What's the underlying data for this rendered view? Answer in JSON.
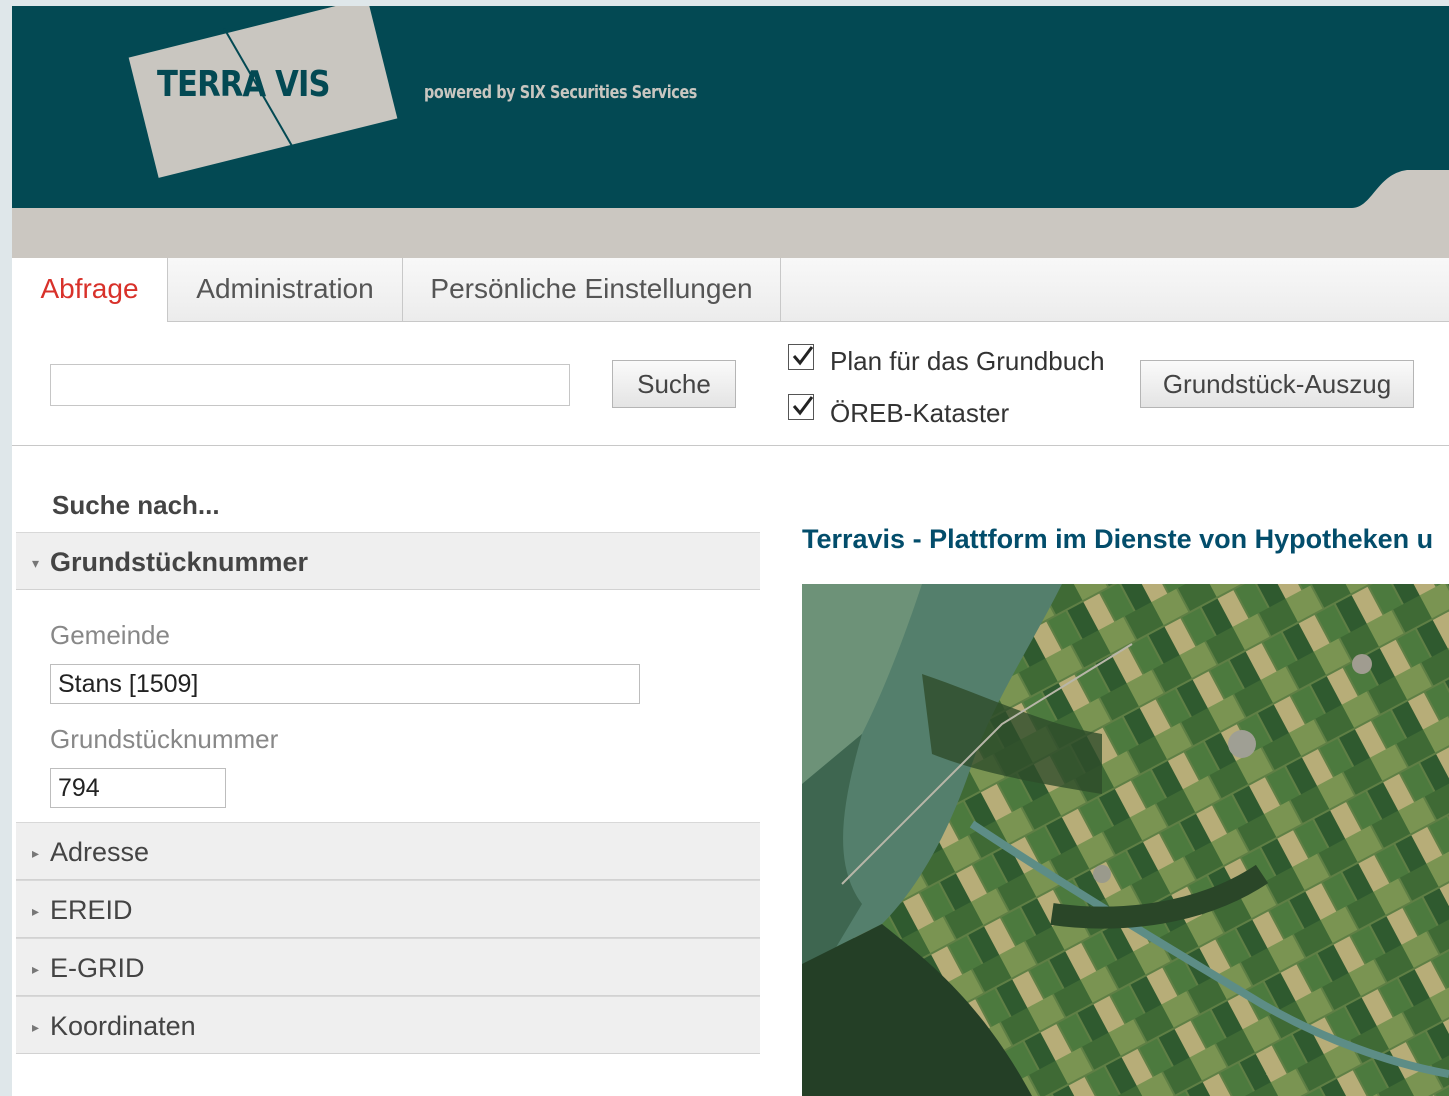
{
  "header": {
    "logo_text": "TERRA VIS",
    "tagline": "powered by SIX Securities Services"
  },
  "tabs": [
    {
      "label": "Abfrage",
      "active": true
    },
    {
      "label": "Administration",
      "active": false
    },
    {
      "label": "Persönliche Einstellungen",
      "active": false
    }
  ],
  "search": {
    "value": "",
    "placeholder": "",
    "button_label": "Suche"
  },
  "options": {
    "plan_label": "Plan für das Grundbuch",
    "plan_checked": true,
    "oereb_label": "ÖREB-Kataster",
    "oereb_checked": true,
    "extract_button_label": "Grundstück-Auszug"
  },
  "sidebar": {
    "heading": "Suche nach...",
    "sections": [
      {
        "label": "Grundstücknummer",
        "expanded": true
      },
      {
        "label": "Adresse",
        "expanded": false
      },
      {
        "label": "EREID",
        "expanded": false
      },
      {
        "label": "E-GRID",
        "expanded": false
      },
      {
        "label": "Koordinaten",
        "expanded": false
      }
    ],
    "grundstuck_form": {
      "gemeinde_label": "Gemeinde",
      "gemeinde_value": "Stans [1509]",
      "nummer_label": "Grundstücknummer",
      "nummer_value": "794"
    }
  },
  "main": {
    "title": "Terravis - Plattform im Dienste von Hypotheken u"
  },
  "colors": {
    "header_bg": "#034953",
    "active_tab": "#d8312a",
    "title": "#034d6b",
    "logo_bg": "#c9c6c0"
  }
}
